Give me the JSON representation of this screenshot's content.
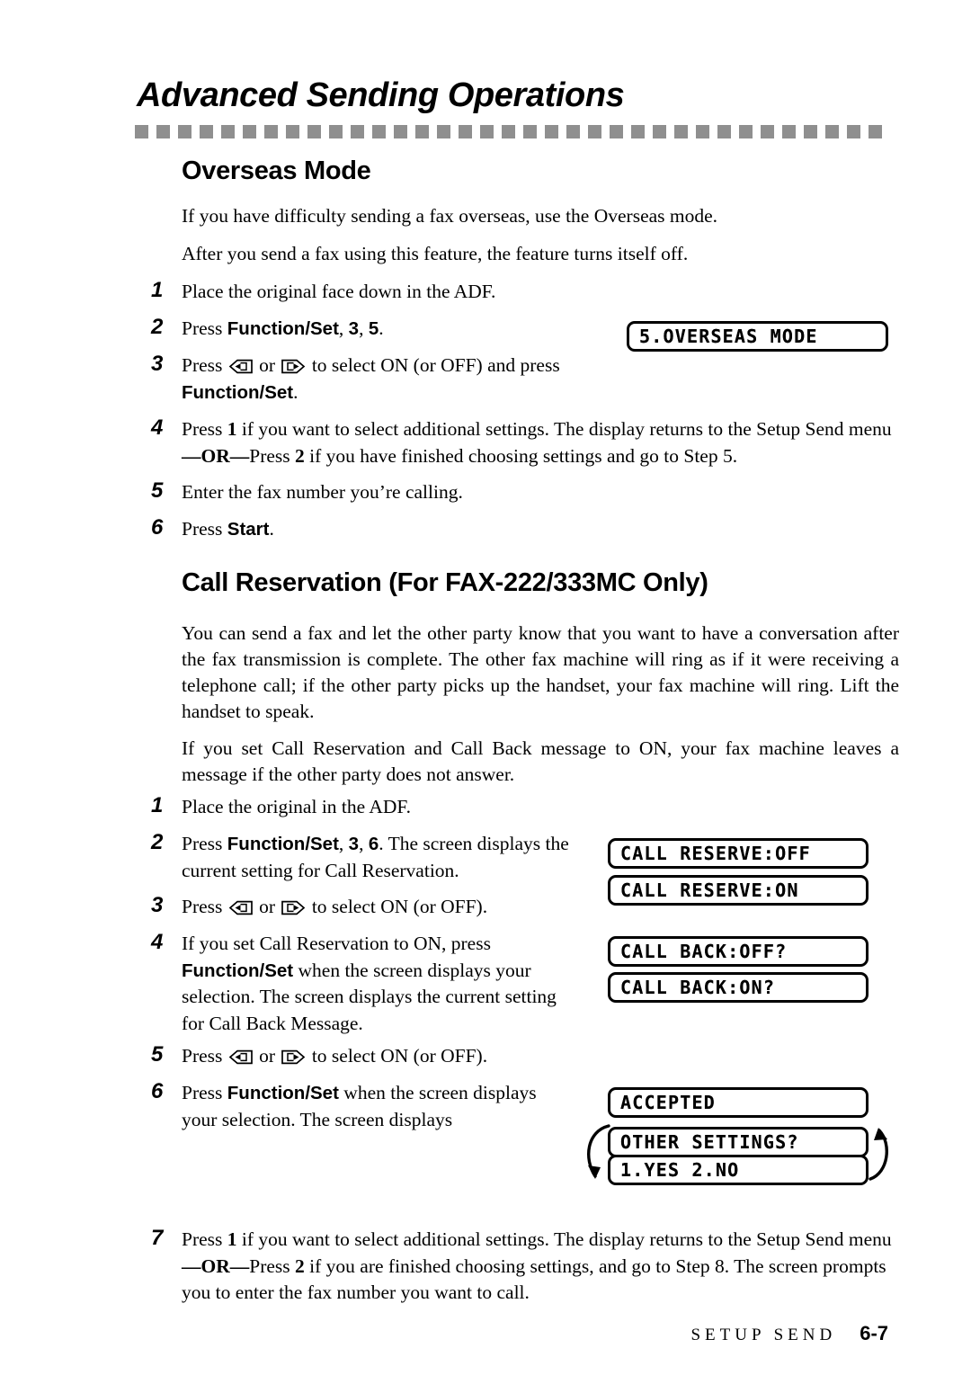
{
  "chapter": {
    "title": "Advanced Sending Operations",
    "rule_squares": 45,
    "rule_color": "#8f8f8f"
  },
  "sections": [
    {
      "heading": "Overseas Mode",
      "paragraphs": [
        "If you have difficulty sending a fax overseas, use the Overseas mode.",
        "After you send a fax using this feature, the feature turns itself off."
      ],
      "steps": [
        {
          "num": "1",
          "text": "Place the original face down in the ADF."
        },
        {
          "num": "2",
          "text_before": "Press ",
          "bold1": "Function/Set",
          "mid": ", ",
          "bold2": "3",
          "mid2": ", ",
          "bold3": "5",
          "text_after": "."
        },
        {
          "num": "3",
          "text": "Press  or  to select ON (or OFF) and press"
        },
        {
          "num": "4",
          "text": "Press 1 if you want to select additional settings. The display returns to the Setup Send menu—OR—Press 2 if you have finished choosing settings and go to Step 5."
        },
        {
          "num": "5",
          "text": "Enter the fax number you’re calling."
        },
        {
          "num": "6",
          "text": "Press Start."
        }
      ]
    },
    {
      "heading": "Call Reservation (For FAX-222/333MC Only)",
      "paragraphs": [
        "You can send a fax and let the other party know that you want to have a conversation after the fax transmission is complete. The other fax machine will ring as if it were receiving a telephone call; if the other party picks up the handset, your fax machine will ring. Lift the handset to speak.",
        "If you set Call Reservation and Call Back message to ON, your fax machine leaves a message if the other party does not answer."
      ]
    }
  ],
  "overseas_steps": {
    "s1": "Place the original face down in the ADF.",
    "s2_pre": "Press ",
    "s2_b1": "Function/Set",
    "s2_sep1": ", ",
    "s2_b2": "3",
    "s2_sep2": ", ",
    "s2_b3": "5",
    "s2_post": ".",
    "s3_pre": "Press ",
    "s3_or": " or ",
    "s3_post": " to select ON (or OFF) and press",
    "s3_line2_bold": "Function/Set",
    "s3_line2_post": ".",
    "s4_pre": "Press ",
    "s4_b1": "1",
    "s4_mid": " if you want to select additional settings. The display returns to the Setup Send menu",
    "s4_or": "—OR—",
    "s4_press": "Press ",
    "s4_b2": "2",
    "s4_post": " if you have finished choosing settings and go to Step 5.",
    "s5": "Enter the fax number you’re calling.",
    "s6_pre": "Press ",
    "s6_b": "Start",
    "s6_post": "."
  },
  "callres_steps": {
    "s1": "Place the original in the ADF.",
    "s2_pre": "Press ",
    "s2_b1": "Function/Set",
    "s2_sep1": ", ",
    "s2_b2": "3",
    "s2_sep2": ", ",
    "s2_b3": "6",
    "s2_post": ". The screen displays the current setting for Call Reservation.",
    "s3_pre": "Press ",
    "s3_or": " or ",
    "s3_post": " to select ON (or OFF).",
    "s4_pre": "If you set Call Reservation to ON, press ",
    "s4_b": "Function/Set",
    "s4_post": " when the screen displays your selection. The screen displays the current setting for Call Back Message.",
    "s5_pre": "Press ",
    "s5_or": " or ",
    "s5_post": " to select ON (or OFF).",
    "s6_pre": "Press ",
    "s6_b": "Function/Set",
    "s6_post": " when the screen displays your selection. The screen displays",
    "s7_pre": "Press ",
    "s7_b1": "1",
    "s7_mid": " if you want to select additional settings. The display returns to the Setup Send menu",
    "s7_or": "—OR—",
    "s7_press": "Press ",
    "s7_b2": "2",
    "s7_post": " if you are finished choosing settings, and go to Step 8. The screen prompts you to enter the fax number you want to call."
  },
  "step_numbers": {
    "n1": "1",
    "n2": "2",
    "n3": "3",
    "n4": "4",
    "n5": "5",
    "n6": "6",
    "n7": "7"
  },
  "lcd_displays": {
    "overseas_mode": "5.OVERSEAS MODE",
    "call_reserve_off": "CALL RESERVE:OFF",
    "call_reserve_on": "CALL RESERVE:ON",
    "call_back_off": "CALL BACK:OFF?",
    "call_back_on": "CALL BACK:ON?",
    "accepted": "ACCEPTED",
    "other_settings": "OTHER SETTINGS?",
    "yes_no": "1.YES 2.NO"
  },
  "footer": {
    "label": "SETUP SEND",
    "page": "6-7"
  },
  "icons": {
    "left_arrow_key": "left-arrow-key-icon",
    "right_arrow_key": "right-arrow-key-icon",
    "cycle_left": "cycle-arrow-left-icon",
    "cycle_right": "cycle-arrow-right-icon"
  }
}
